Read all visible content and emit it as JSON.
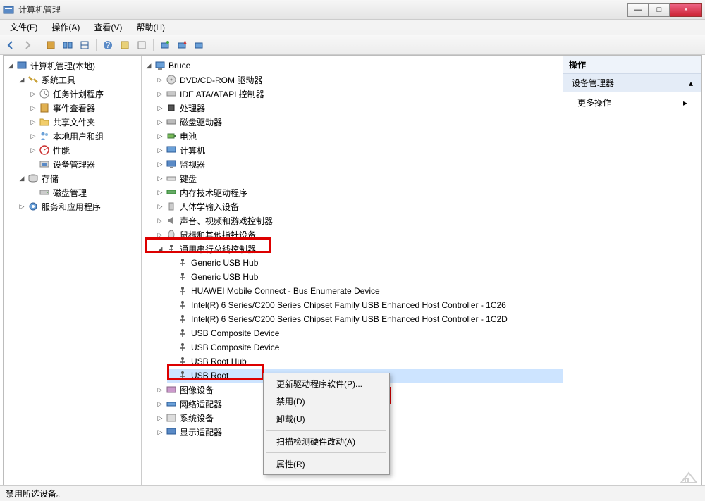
{
  "window": {
    "title": "计算机管理",
    "min": "—",
    "max": "□",
    "close": "×"
  },
  "menu": {
    "file": "文件(F)",
    "action": "操作(A)",
    "view": "查看(V)",
    "help": "帮助(H)"
  },
  "left_tree": {
    "root": "计算机管理(本地)",
    "system_tools": "系统工具",
    "task_scheduler": "任务计划程序",
    "event_viewer": "事件查看器",
    "shared_folders": "共享文件夹",
    "local_users": "本地用户和组",
    "performance": "性能",
    "device_manager": "设备管理器",
    "storage": "存储",
    "disk_management": "磁盘管理",
    "services_apps": "服务和应用程序"
  },
  "center_tree": {
    "root": "Bruce",
    "dvd": "DVD/CD-ROM 驱动器",
    "ide": "IDE ATA/ATAPI 控制器",
    "cpu": "处理器",
    "disk_drives": "磁盘驱动器",
    "battery": "电池",
    "computer": "计算机",
    "monitor": "监视器",
    "keyboard": "键盘",
    "memory": "内存技术驱动程序",
    "hid": "人体学输入设备",
    "sound": "声音、视频和游戏控制器",
    "mouse": "鼠标和其他指针设备",
    "usb_controllers": "通用串行总线控制器",
    "usb_items": [
      "Generic USB Hub",
      "Generic USB Hub",
      "HUAWEI Mobile Connect - Bus Enumerate Device",
      "Intel(R) 6 Series/C200 Series Chipset Family USB Enhanced Host Controller - 1C26",
      "Intel(R) 6 Series/C200 Series Chipset Family USB Enhanced Host Controller - 1C2D",
      "USB Composite Device",
      "USB Composite Device",
      "USB Root Hub",
      "USB Root"
    ],
    "image_devices": "图像设备",
    "network_adapters": "网络适配器",
    "system_devices": "系统设备",
    "display_adapters": "显示适配器"
  },
  "context_menu": {
    "update": "更新驱动程序软件(P)...",
    "disable": "禁用(D)",
    "uninstall": "卸载(U)",
    "scan": "扫描检测硬件改动(A)",
    "properties": "属性(R)"
  },
  "right_panel": {
    "header": "操作",
    "section": "设备管理器",
    "more_actions": "更多操作"
  },
  "status": "禁用所选设备。",
  "icons": {
    "back": "←",
    "forward": "→"
  }
}
